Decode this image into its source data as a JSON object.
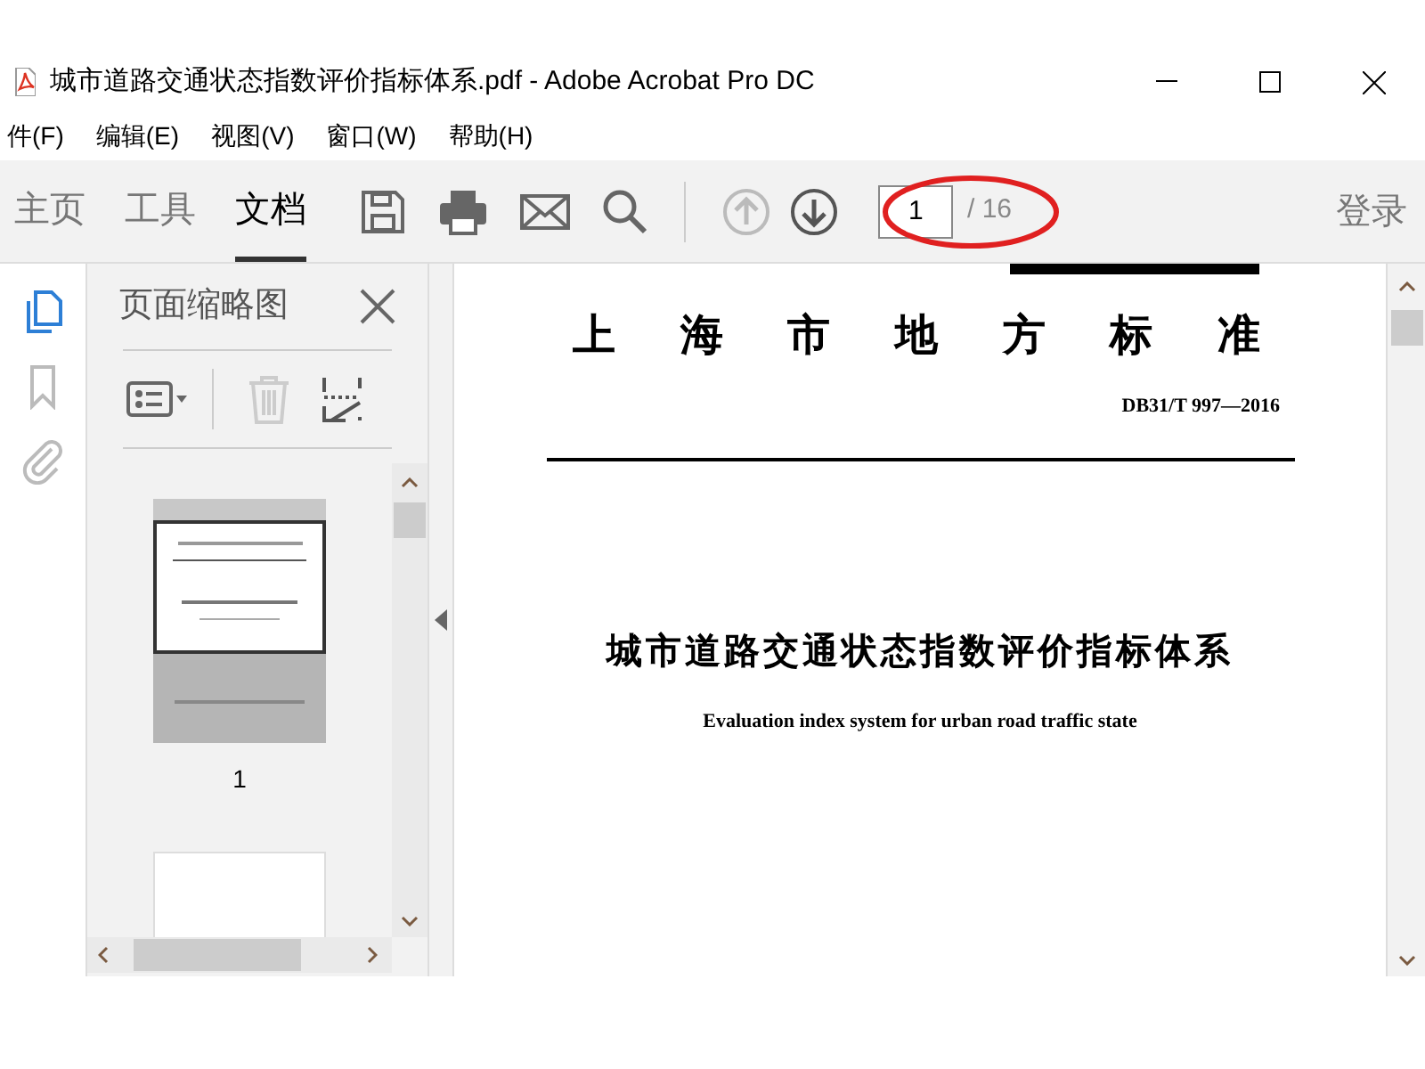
{
  "window": {
    "title": "城市道路交通状态指数评价指标体系.pdf - Adobe Acrobat Pro DC"
  },
  "menu": [
    "件(F)",
    "编辑(E)",
    "视图(V)",
    "窗口(W)",
    "帮助(H)"
  ],
  "tabs": [
    {
      "label": "主页",
      "selected": false
    },
    {
      "label": "工具",
      "selected": false
    },
    {
      "label": "文档",
      "selected": true
    }
  ],
  "page_nav": {
    "value": "1",
    "total": "/ 16",
    "annotated": true
  },
  "sign_in": "登录",
  "side_rail": [
    {
      "kind": "pages",
      "selected": true
    },
    {
      "kind": "bookmarks",
      "selected": false
    },
    {
      "kind": "attachments",
      "selected": false
    }
  ],
  "thumbnail_panel": {
    "title": "页面缩略图",
    "thumbnails": [
      {
        "label": "1",
        "selected": true
      },
      {
        "selected": false
      }
    ]
  },
  "document": {
    "heading": "上 海 市 地 方 标 准",
    "code": "DB31/T 997—2016",
    "title": "城市道路交通状态指数评价指标体系",
    "subtitle": "Evaluation index system for urban road traffic state"
  }
}
